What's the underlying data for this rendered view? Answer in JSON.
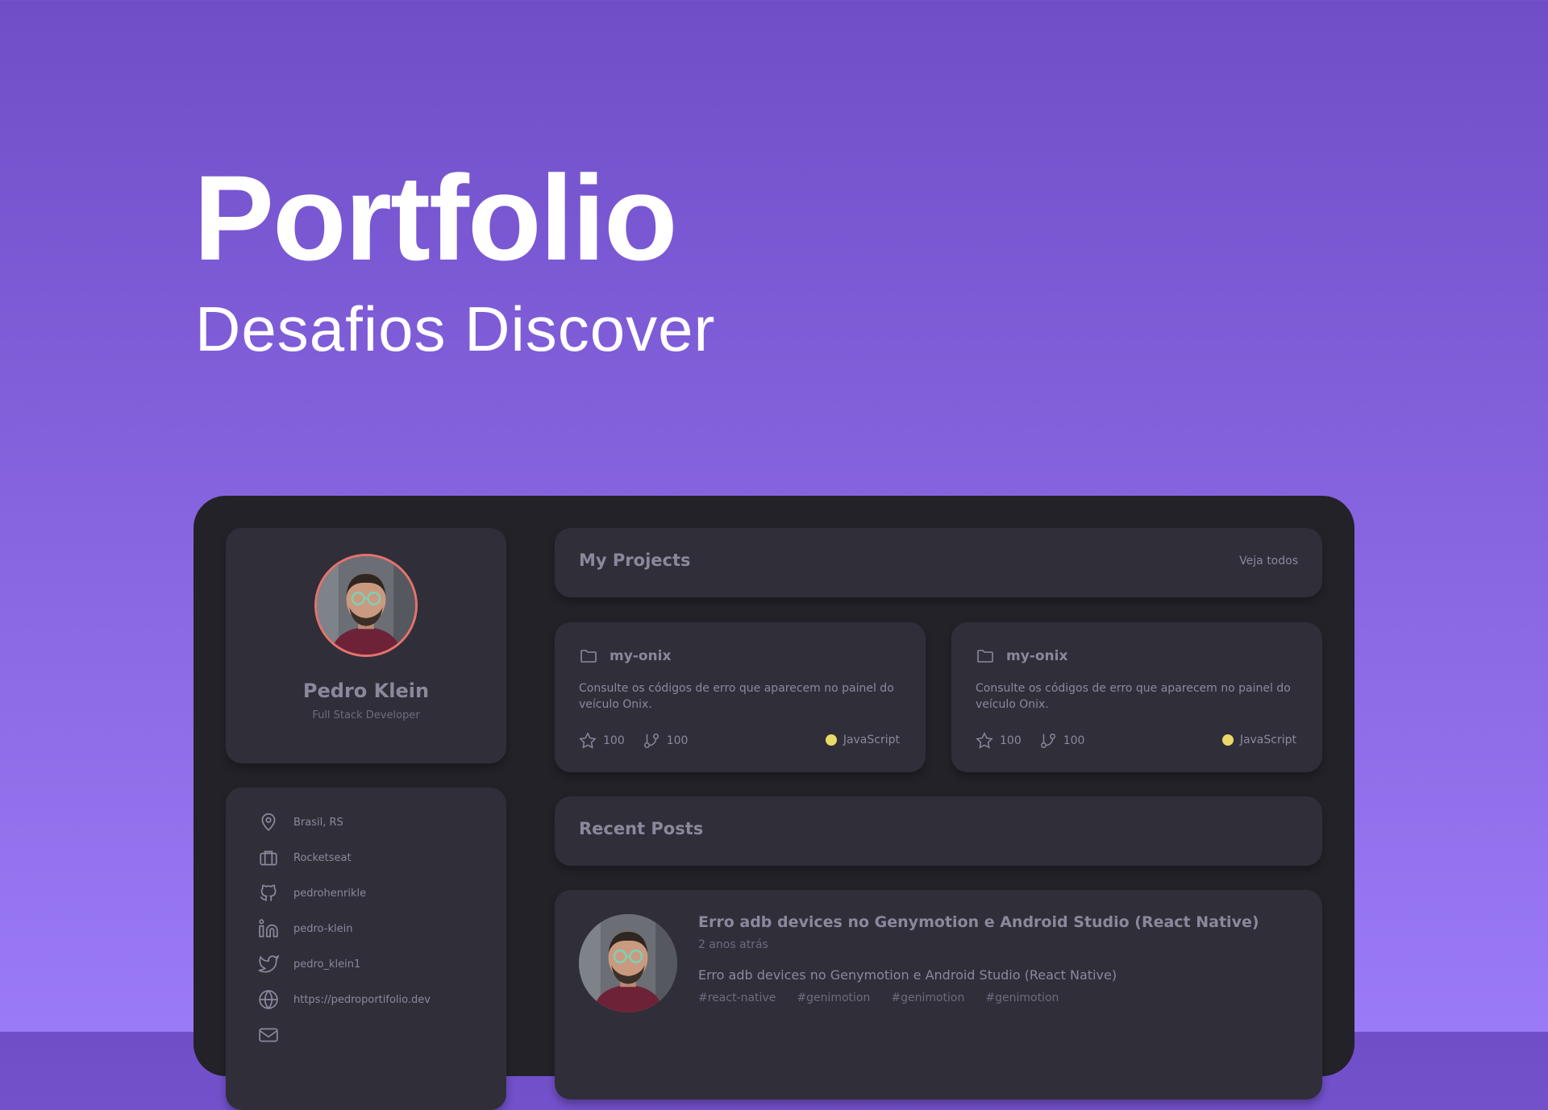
{
  "hero": {
    "title": "Portfolio",
    "subtitle": "Desafios Discover"
  },
  "profile": {
    "name": "Pedro Klein",
    "role": "Full Stack Developer"
  },
  "info": [
    {
      "icon": "map-pin-icon",
      "text": "Brasil, RS"
    },
    {
      "icon": "briefcase-icon",
      "text": "Rocketseat"
    },
    {
      "icon": "github-icon",
      "text": "pedrohenrikle"
    },
    {
      "icon": "linkedin-icon",
      "text": "pedro-klein"
    },
    {
      "icon": "twitter-icon",
      "text": "pedro_klein1"
    },
    {
      "icon": "globe-icon",
      "text": "https://pedroportifolio.dev"
    }
  ],
  "projects": {
    "title": "My Projects",
    "see_all": "Veja todos",
    "items": [
      {
        "name": "my-onix",
        "description": "Consulte os códigos de erro que aparecem no painel do veículo Onix.",
        "stars": "100",
        "forks": "100",
        "language": "JavaScript"
      },
      {
        "name": "my-onix",
        "description": "Consulte os códigos de erro que aparecem no painel do veículo Onix.",
        "stars": "100",
        "forks": "100",
        "language": "JavaScript"
      }
    ]
  },
  "posts": {
    "title": "Recent Posts",
    "items": [
      {
        "title": "Erro adb devices no Genymotion e Android Studio (React Native)",
        "date": "2 anos atrás",
        "body": "Erro adb devices no Genymotion e Android Studio (React Native)",
        "tags": [
          "#react-native",
          "#genimotion",
          "#genimotion",
          "#genimotion"
        ]
      }
    ]
  },
  "colors": {
    "javascript": "#e9d96a",
    "avatar_ring": "#e6736c"
  }
}
